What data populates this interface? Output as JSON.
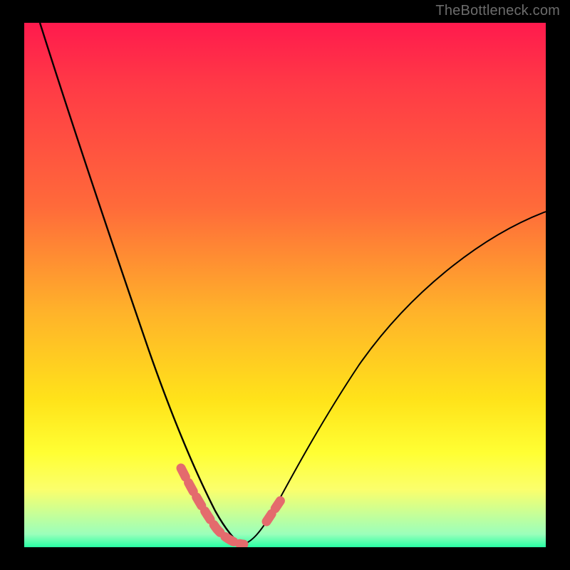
{
  "watermark": "TheBottleneck.com",
  "chart_data": {
    "type": "line",
    "title": "",
    "xlabel": "",
    "ylabel": "",
    "xlim": [
      0,
      100
    ],
    "ylim": [
      0,
      100
    ],
    "series": [
      {
        "name": "left-curve",
        "x": [
          3,
          6,
          10,
          14,
          18,
          22,
          26,
          30,
          33,
          35,
          37,
          39,
          41
        ],
        "y": [
          100,
          87,
          71,
          57,
          45,
          34,
          24,
          15,
          9,
          5,
          2.5,
          1,
          0.5
        ]
      },
      {
        "name": "right-curve",
        "x": [
          42,
          44,
          46,
          49,
          53,
          58,
          65,
          75,
          88,
          100
        ],
        "y": [
          0.5,
          1.5,
          4,
          9,
          17,
          26,
          36,
          47,
          57,
          64
        ]
      },
      {
        "name": "marker-band-left",
        "x": [
          30,
          31.5,
          33,
          34.5,
          36,
          37.5,
          39,
          40.5,
          42
        ],
        "y": [
          14.5,
          11.5,
          8.8,
          6.3,
          4.2,
          2.5,
          1.3,
          0.7,
          0.5
        ]
      },
      {
        "name": "marker-band-right",
        "x": [
          46,
          47.5,
          49
        ],
        "y": [
          4.5,
          6.8,
          9.2
        ]
      }
    ],
    "colors": {
      "curve": "#000000",
      "markers": "#e46b6d",
      "gradient_top": "#ff1a4d",
      "gradient_mid": "#ffe31a",
      "gradient_bottom": "#28ffa4"
    }
  }
}
